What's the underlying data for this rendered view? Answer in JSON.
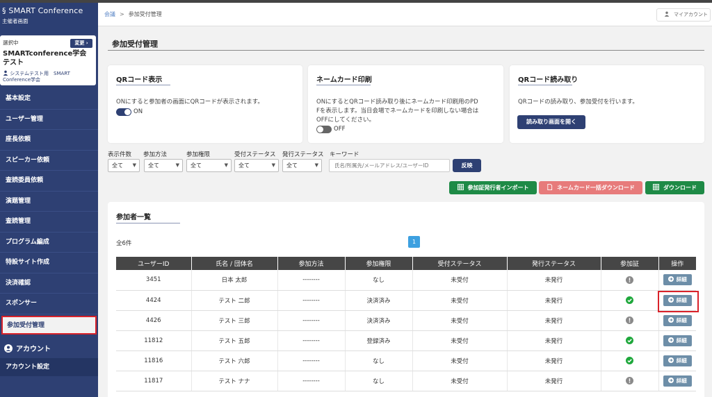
{
  "sidebar": {
    "brand_title": "SMART Conference",
    "brand_subtitle": "主催者画面",
    "selected": {
      "label": "選択中",
      "change_button": "変更",
      "name": "SMARTconference学会　テスト",
      "user": "システムテスト用　SMART Conference学会"
    },
    "items": [
      {
        "label": "基本設定"
      },
      {
        "label": "ユーザー管理"
      },
      {
        "label": "座長依頼"
      },
      {
        "label": "スピーカー依頼"
      },
      {
        "label": "査読委員依頼"
      },
      {
        "label": "演題管理"
      },
      {
        "label": "査読管理"
      },
      {
        "label": "プログラム編成"
      },
      {
        "label": "特設サイト作成"
      },
      {
        "label": "決済確認"
      },
      {
        "label": "スポンサー"
      },
      {
        "label": "参加受付管理",
        "active": true
      }
    ],
    "account_header": "アカウント",
    "account_settings": "アカウント設定"
  },
  "header": {
    "breadcrumb_root": "会議",
    "breadcrumb_sep": ">",
    "breadcrumb_current": "参加受付管理",
    "my_account": "マイアカウント"
  },
  "page_title": "参加受付管理",
  "cards": {
    "qr_display": {
      "title": "QRコード表示",
      "desc": "ONにすると参加者の画面にQRコードが表示されます。",
      "toggle_label": "ON",
      "toggle_on": true
    },
    "namecard": {
      "title": "ネームカード印刷",
      "desc1": "ONにするとQRコード読み取り後にネームカード印刷用のPD",
      "desc2": "Fを表示します。当日会場でネームカードを印刷しない場合は",
      "desc3": "OFFにしてください。",
      "toggle_label": "OFF",
      "toggle_on": false
    },
    "qr_read": {
      "title": "QRコード読み取り",
      "desc": "QRコードの読み取り、参加受付を行います。",
      "button": "読み取り画面を開く"
    }
  },
  "filters": {
    "labels": [
      "表示件数",
      "参加方法",
      "参加権限",
      "受付ステータス",
      "発行ステータス",
      "キーワード"
    ],
    "values": [
      "全て",
      "全て",
      "全て",
      "全て",
      "全て"
    ],
    "keyword_placeholder": "氏名/所属先/メールアドレス/ユーザーID",
    "apply_button": "反映"
  },
  "actions": {
    "import": "参加証発行者インポート",
    "namecard_download": "ネームカード一括ダウンロード",
    "download": "ダウンロード"
  },
  "list": {
    "title": "参加者一覧",
    "count": "全6件",
    "page": "1",
    "columns": [
      "ユーザーID",
      "氏名 / 団体名",
      "参加方法",
      "参加権限",
      "受付ステータス",
      "発行ステータス",
      "参加証",
      "操作"
    ],
    "detail_label": "詳細",
    "rows": [
      {
        "id": "3451",
        "name": "日本 太郎",
        "method": "--------",
        "auth": "なし",
        "reception": "未受付",
        "issue": "未発行",
        "badge": "pending"
      },
      {
        "id": "4424",
        "name": "テスト 二郎",
        "method": "--------",
        "auth": "決済済み",
        "reception": "未受付",
        "issue": "未発行",
        "badge": "ok"
      },
      {
        "id": "4426",
        "name": "テスト 三郎",
        "method": "--------",
        "auth": "決済済み",
        "reception": "未受付",
        "issue": "未発行",
        "badge": "pending"
      },
      {
        "id": "11812",
        "name": "テスト 五郎",
        "method": "--------",
        "auth": "登録済み",
        "reception": "未受付",
        "issue": "未発行",
        "badge": "ok"
      },
      {
        "id": "11816",
        "name": "テスト 六郎",
        "method": "--------",
        "auth": "なし",
        "reception": "未受付",
        "issue": "未発行",
        "badge": "ok"
      },
      {
        "id": "11817",
        "name": "テスト ナナ",
        "method": "--------",
        "auth": "なし",
        "reception": "未受付",
        "issue": "未発行",
        "badge": "pending"
      }
    ]
  },
  "colors": {
    "sidebar": "#2e4073",
    "accent_green": "#1e8a46",
    "accent_pink": "#e77b7b",
    "highlight_red": "#d9222a",
    "page_blue": "#3da0e0"
  }
}
